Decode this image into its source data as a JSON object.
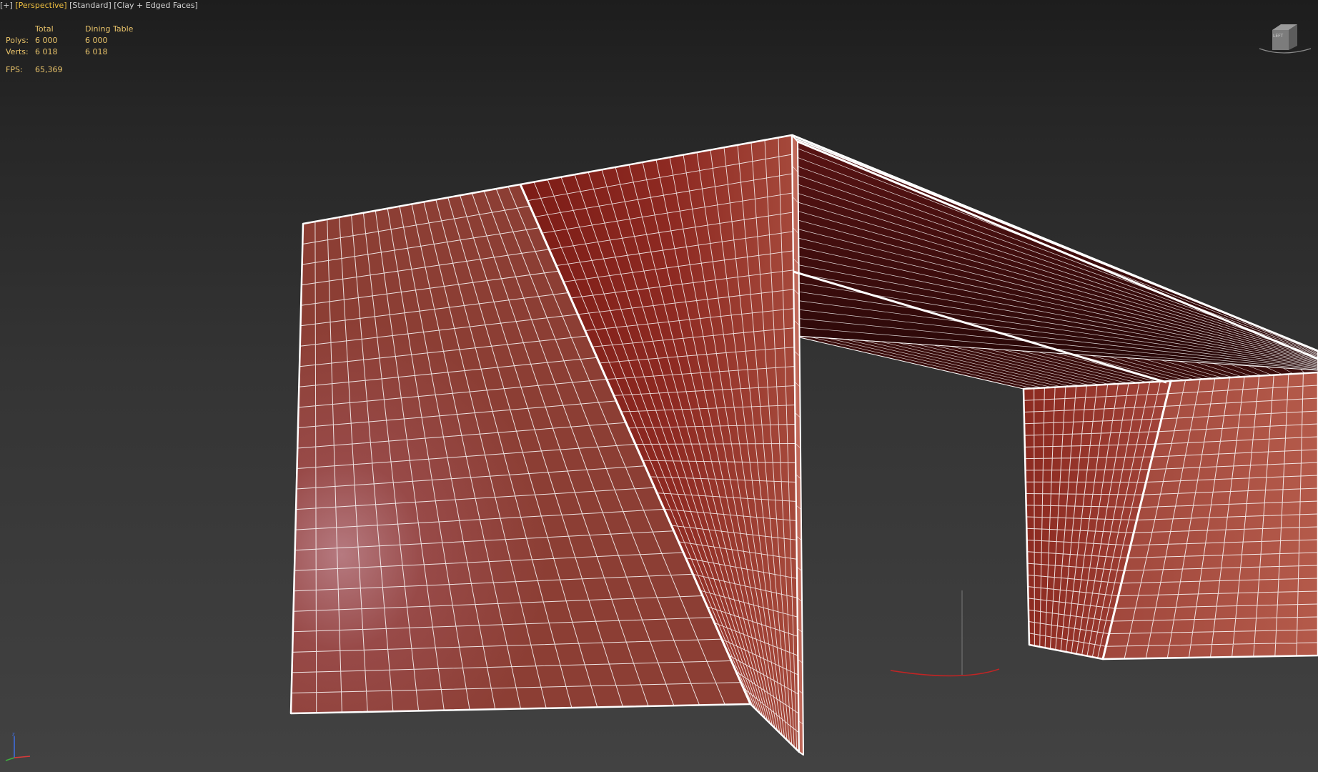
{
  "viewport": {
    "label_parts": [
      "[+]",
      "[Perspective]",
      "[Standard]",
      "[Clay + Edged Faces]"
    ]
  },
  "stats": {
    "headers": [
      "",
      "Total",
      "Dining Table"
    ],
    "rows": [
      {
        "label": "Polys:",
        "total": "6 000",
        "selected": "6 000"
      },
      {
        "label": "Verts:",
        "total": "6 018",
        "selected": "6 018"
      }
    ],
    "fps_label": "FPS:",
    "fps_value": "65,369"
  },
  "colors": {
    "active_view": "#f0c040",
    "stats_text": "#e9c36a",
    "clay": "#9a3f36",
    "wire": "#ffffff"
  },
  "icons": [
    "viewcube-icon",
    "axis-tripod-icon",
    "pivot-gizmo-icon"
  ]
}
